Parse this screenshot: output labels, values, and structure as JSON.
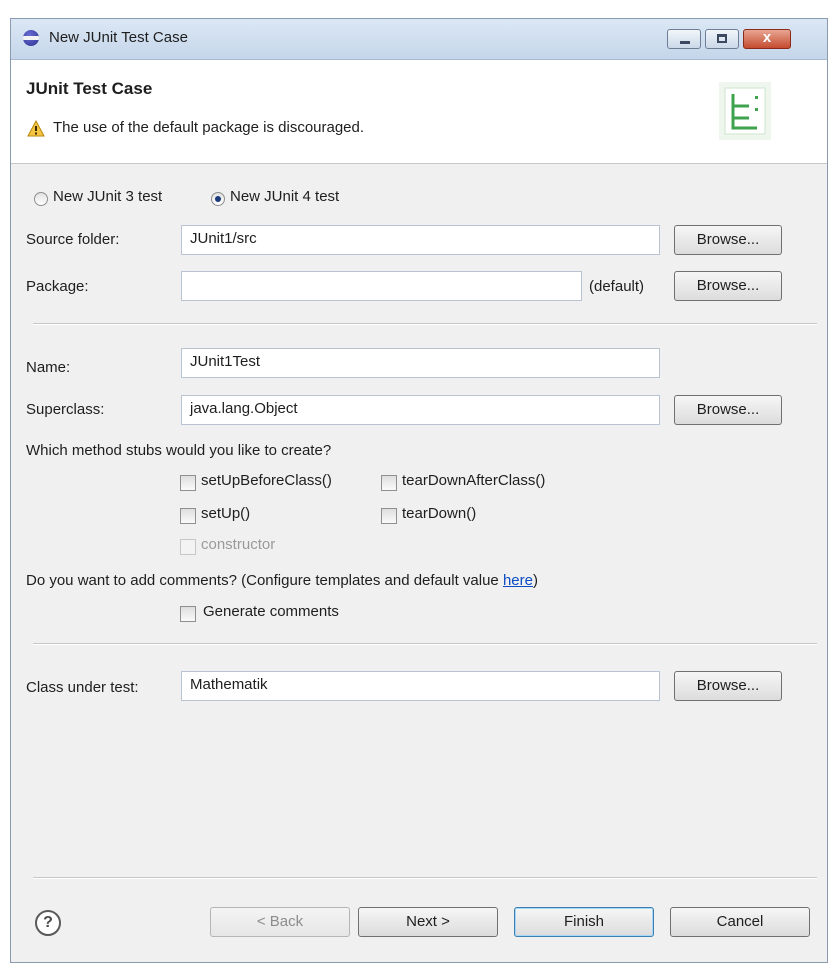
{
  "window": {
    "title": "New JUnit Test Case",
    "close_glyph": "x"
  },
  "header": {
    "title": "JUnit Test Case",
    "message": "The use of the default package is discouraged."
  },
  "radios": {
    "junit3": "New JUnit 3 test",
    "junit4": "New JUnit 4 test",
    "selected": "junit4"
  },
  "source_folder": {
    "label": "Source folder:",
    "value": "JUnit1/src",
    "browse": "Browse..."
  },
  "package": {
    "label": "Package:",
    "value": "",
    "default_label": "(default)",
    "browse": "Browse..."
  },
  "name": {
    "label": "Name:",
    "value": "JUnit1Test"
  },
  "superclass": {
    "label": "Superclass:",
    "value": "java.lang.Object",
    "browse": "Browse..."
  },
  "stubs": {
    "question": "Which method stubs would you like to create?",
    "setUpBeforeClass": "setUpBeforeClass()",
    "tearDownAfterClass": "tearDownAfterClass()",
    "setUp": "setUp()",
    "tearDown": "tearDown()",
    "constructor": "constructor"
  },
  "comments": {
    "question": "Do you want to add comments? (Configure templates and default value ",
    "link": "here",
    "close_paren": ")",
    "generate": "Generate comments"
  },
  "class_under_test": {
    "label": "Class under test:",
    "value": "Mathematik",
    "browse": "Browse..."
  },
  "footer": {
    "help": "?",
    "back": "< Back",
    "next": "Next >",
    "finish": "Finish",
    "cancel": "Cancel"
  },
  "icons": [
    "eclipse-icon",
    "minimize-icon",
    "maximize-icon",
    "close-icon",
    "warning-icon",
    "junit-banner-icon",
    "help-icon"
  ]
}
